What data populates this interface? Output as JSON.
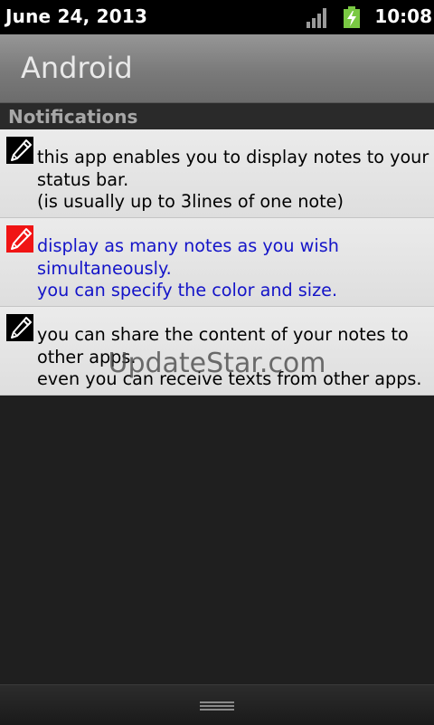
{
  "status_bar": {
    "date": "June 24, 2013",
    "time": "10:08",
    "icons": [
      "signal-icon",
      "battery-charging-icon"
    ],
    "battery_color": "#7ac943"
  },
  "title_bar": {
    "title": "Android"
  },
  "section": {
    "title": "Notifications"
  },
  "notes": [
    {
      "icon": "pencil-edit-icon",
      "icon_color": "#000000",
      "text_color": "#000000",
      "lines": [
        "this app enables you to display notes to your",
        "status bar.",
        "(is usually up to 3lines of one note)"
      ]
    },
    {
      "icon": "pencil-edit-icon",
      "icon_color": "#f01414",
      "text_color": "#1414c8",
      "lines": [
        "display as many notes as you wish",
        "simultaneously.",
        "you can specify the color and size."
      ]
    },
    {
      "icon": "pencil-edit-icon",
      "icon_color": "#000000",
      "text_color": "#000000",
      "lines": [
        "you can share the content of your notes to",
        "other apps.",
        "even you can receive texts from other apps."
      ]
    }
  ],
  "watermark": "UpdateStar.com",
  "bottom_bar": {
    "icon": "drag-handle-icon"
  }
}
